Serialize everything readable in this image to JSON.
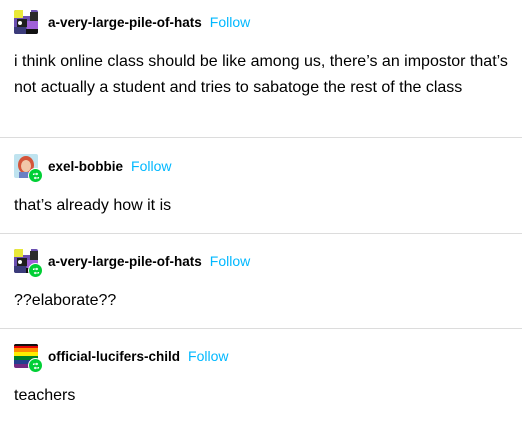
{
  "colors": {
    "follow": "#00b8ff",
    "reblog_badge": "#00cf35",
    "divider": "#dcdcdc"
  },
  "posts": [
    {
      "username": "a-very-large-pile-of-hats",
      "follow_label": "Follow",
      "avatar": "hats-avatar",
      "reblog": false,
      "text": "i think online class should be like among us, there’s an impostor that’s not actually a student and tries to sabatoge the rest of the class"
    },
    {
      "username": "exel-bobbie",
      "follow_label": "Follow",
      "avatar": "bobbie-avatar",
      "reblog": true,
      "text": "that’s already how it is"
    },
    {
      "username": "a-very-large-pile-of-hats",
      "follow_label": "Follow",
      "avatar": "hats-avatar",
      "reblog": true,
      "text": "??elaborate??"
    },
    {
      "username": "official-lucifers-child",
      "follow_label": "Follow",
      "avatar": "pride-flag-avatar",
      "reblog": true,
      "text": "teachers"
    }
  ]
}
